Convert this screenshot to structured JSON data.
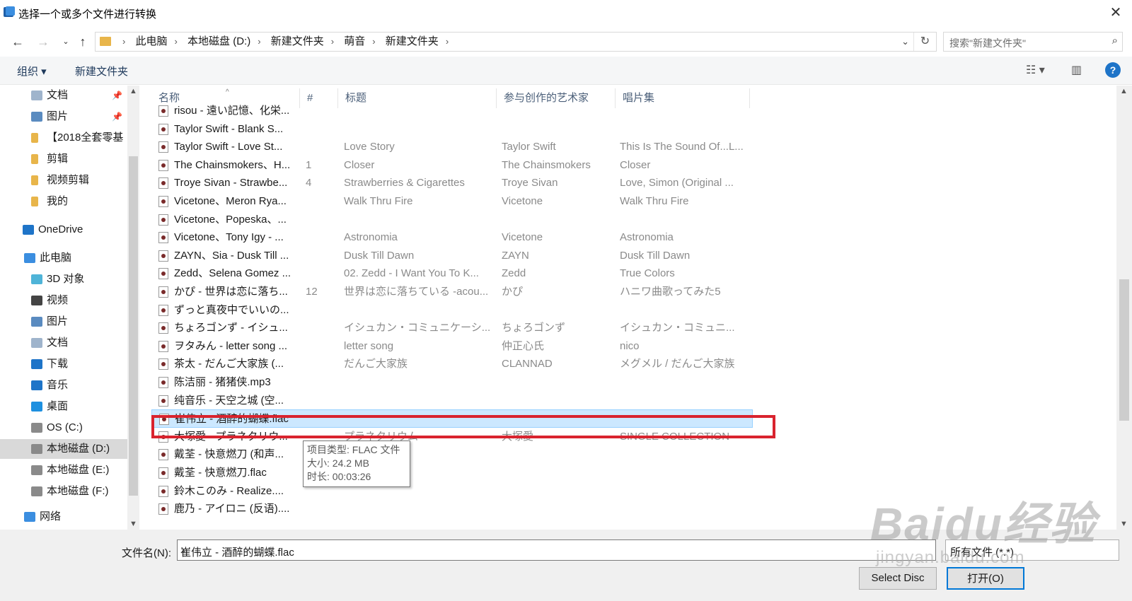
{
  "window": {
    "title": "选择一个或多个文件进行转换"
  },
  "address": {
    "crumbs": [
      "此电脑",
      "本地磁盘 (D:)",
      "新建文件夹",
      "萌音",
      "新建文件夹"
    ],
    "search_placeholder": "搜索\"新建文件夹\""
  },
  "toolbar": {
    "organize": "组织 ▾",
    "new_folder": "新建文件夹"
  },
  "leftnav": [
    {
      "label": "文档",
      "icon": "document-icon",
      "pinned": true
    },
    {
      "label": "图片",
      "icon": "picture-icon",
      "pinned": true
    },
    {
      "label": "【2018全套零基",
      "icon": "folder-icon",
      "pinned": false
    },
    {
      "label": "剪辑",
      "icon": "folder-icon",
      "pinned": false
    },
    {
      "label": "视频剪辑",
      "icon": "folder-icon",
      "pinned": false
    },
    {
      "label": "我的",
      "icon": "folder-icon",
      "pinned": false
    },
    {
      "label": "OneDrive",
      "icon": "onedrive-icon",
      "pinned": false
    },
    {
      "label": "此电脑",
      "icon": "computer-icon",
      "pinned": false
    },
    {
      "label": "3D 对象",
      "icon": "3d-objects-icon",
      "pinned": false
    },
    {
      "label": "视频",
      "icon": "video-icon",
      "pinned": false
    },
    {
      "label": "图片",
      "icon": "picture-icon",
      "pinned": false
    },
    {
      "label": "文档",
      "icon": "document-icon",
      "pinned": false
    },
    {
      "label": "下载",
      "icon": "download-icon",
      "pinned": false
    },
    {
      "label": "音乐",
      "icon": "music-icon",
      "pinned": false
    },
    {
      "label": "桌面",
      "icon": "desktop-icon",
      "pinned": false
    },
    {
      "label": "OS (C:)",
      "icon": "drive-icon",
      "pinned": false
    },
    {
      "label": "本地磁盘 (D:)",
      "icon": "drive-icon",
      "pinned": false
    },
    {
      "label": "本地磁盘 (E:)",
      "icon": "drive-icon",
      "pinned": false
    },
    {
      "label": "本地磁盘 (F:)",
      "icon": "drive-icon",
      "pinned": false
    },
    {
      "label": "网络",
      "icon": "network-icon",
      "pinned": false
    }
  ],
  "columns": {
    "name": "名称",
    "num": "#",
    "title": "标题",
    "artist": "参与创作的艺术家",
    "album": "唱片集"
  },
  "files": [
    {
      "name": "risou - 遠い記憶、化栄...",
      "num": "",
      "title": "",
      "artist": "",
      "album": ""
    },
    {
      "name": "Taylor Swift - Blank S...",
      "num": "",
      "title": "",
      "artist": "",
      "album": ""
    },
    {
      "name": "Taylor Swift - Love St...",
      "num": "",
      "title": "Love Story",
      "artist": "Taylor Swift",
      "album": "This Is The Sound Of...L..."
    },
    {
      "name": "The Chainsmokers、H...",
      "num": "1",
      "title": "Closer",
      "artist": "The Chainsmokers",
      "album": "Closer"
    },
    {
      "name": "Troye Sivan - Strawbe...",
      "num": "4",
      "title": "Strawberries & Cigarettes",
      "artist": "Troye Sivan",
      "album": "Love, Simon (Original ..."
    },
    {
      "name": "Vicetone、Meron Rya...",
      "num": "",
      "title": "Walk Thru Fire",
      "artist": "Vicetone",
      "album": "Walk Thru Fire"
    },
    {
      "name": "Vicetone、Popeska、...",
      "num": "",
      "title": "",
      "artist": "",
      "album": ""
    },
    {
      "name": "Vicetone、Tony Igy - ...",
      "num": "",
      "title": "Astronomia",
      "artist": "Vicetone",
      "album": "Astronomia"
    },
    {
      "name": "ZAYN、Sia - Dusk Till ...",
      "num": "",
      "title": "Dusk Till Dawn",
      "artist": "ZAYN",
      "album": "Dusk Till Dawn"
    },
    {
      "name": "Zedd、Selena Gomez ...",
      "num": "",
      "title": "02. Zedd - I Want You To K...",
      "artist": "Zedd",
      "album": "True Colors"
    },
    {
      "name": "かぴ - 世界は恋に落ち...",
      "num": "12",
      "title": "世界は恋に落ちている -acou...",
      "artist": "かぴ",
      "album": "ハニワ曲歌ってみた5"
    },
    {
      "name": "ずっと真夜中でいいの...",
      "num": "",
      "title": "",
      "artist": "",
      "album": ""
    },
    {
      "name": "ちょろゴンず - イシュ...",
      "num": "",
      "title": "イシュカン・コミュニケーシ...",
      "artist": "ちょろゴンず",
      "album": "イシュカン・コミュニ..."
    },
    {
      "name": "ヲタみん - letter song ...",
      "num": "",
      "title": "letter song",
      "artist": "仲正心氏",
      "album": "nico"
    },
    {
      "name": "茶太 - だんご大家族 (...",
      "num": "",
      "title": "だんご大家族",
      "artist": "CLANNAD",
      "album": "メグメル / だんご大家族"
    },
    {
      "name": "陈洁丽 - 猪猪侠.mp3",
      "num": "",
      "title": "",
      "artist": "",
      "album": ""
    },
    {
      "name": "纯音乐 - 天空之城 (空...",
      "num": "",
      "title": "",
      "artist": "",
      "album": ""
    },
    {
      "name": "崔伟立 - 酒醉的蝴蝶.flac",
      "num": "",
      "title": "",
      "artist": "",
      "album": "",
      "selected": true
    },
    {
      "name": "大塚愛 - プラネタリウ...",
      "num": "",
      "title": "プラネタリウム",
      "artist": "大塚愛",
      "album": "SINGLE COLLECTION"
    },
    {
      "name": "戴荃 - 快意燃刀 (和声...",
      "num": "",
      "title": "",
      "artist": "",
      "album": ""
    },
    {
      "name": "戴荃 - 快意燃刀.flac",
      "num": "",
      "title": "",
      "artist": "",
      "album": ""
    },
    {
      "name": "鈴木このみ - Realize....",
      "num": "",
      "title": "",
      "artist": "",
      "album": ""
    },
    {
      "name": "鹿乃 - アイロニ (反语)....",
      "num": "",
      "title": "",
      "artist": "",
      "album": ""
    }
  ],
  "tooltip": {
    "line1": "项目类型: FLAC 文件",
    "line2": "大小: 24.2 MB",
    "line3": "时长: 00:03:26"
  },
  "bottom": {
    "filename_label": "文件名(N):",
    "filename_value": "崔伟立 - 酒醉的蝴蝶.flac",
    "filetype": "所有文件 (*.*)",
    "select_disc": "Select Disc",
    "open": "打开(O)"
  },
  "watermark": {
    "brand": "Baidu经验",
    "url": "jingyan.baidu.com"
  },
  "colors": {
    "selection": "#cce8ff",
    "highlight_border": "#d9232e",
    "accent": "#0078d7"
  }
}
